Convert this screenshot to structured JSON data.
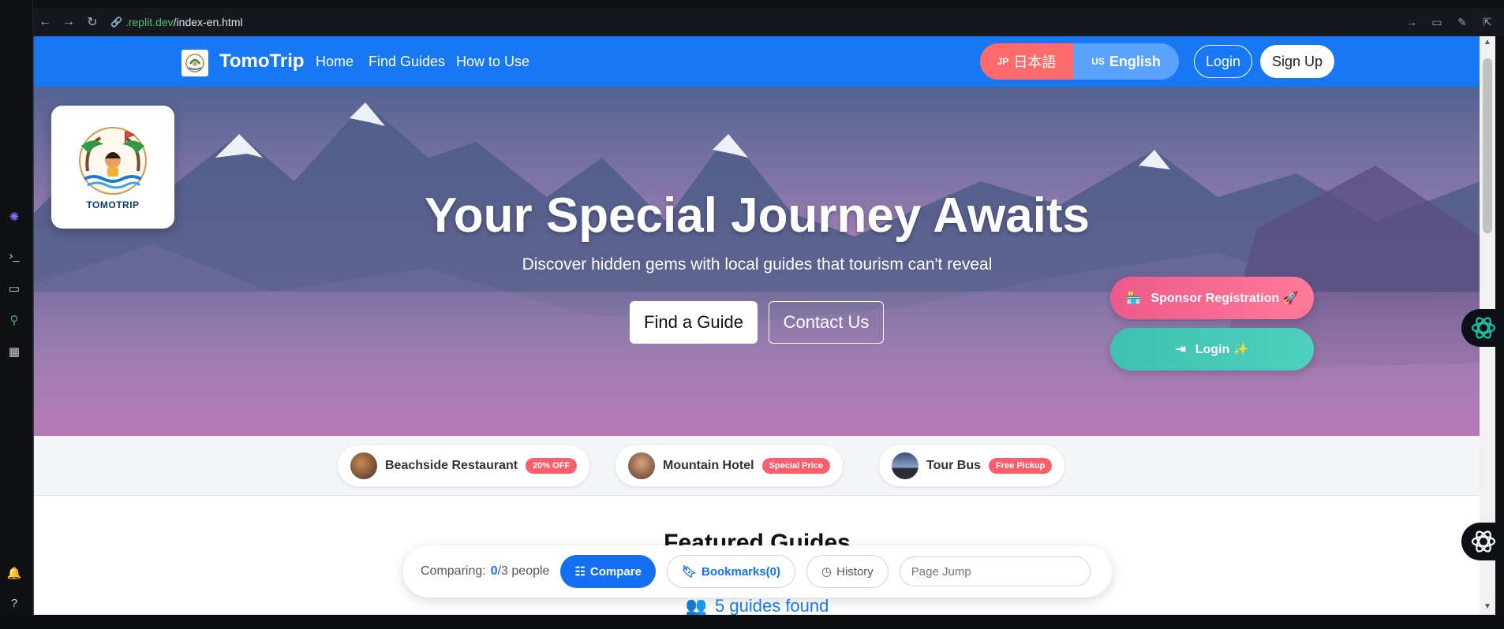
{
  "browser": {
    "url_domain": ".replit.dev",
    "url_path": "/index-en.html"
  },
  "nav": {
    "brand": "TomoTrip",
    "links": [
      "Home",
      "Find Guides",
      "How to Use"
    ],
    "lang_jp_code": "JP",
    "lang_jp_label": "日本語",
    "lang_en_code": "US",
    "lang_en_label": "English",
    "login": "Login",
    "signup": "Sign Up"
  },
  "hero": {
    "logo_label": "TOMOTRIP",
    "title": "Your Special Journey Awaits",
    "subtitle": "Discover hidden gems with local guides that tourism can't reveal",
    "find_guide": "Find a Guide",
    "contact_us": "Contact Us",
    "sponsor_registration": "Sponsor Registration 🚀",
    "side_login": "Login ✨"
  },
  "sponsors": [
    {
      "name": "Beachside Restaurant",
      "tag": "20% OFF"
    },
    {
      "name": "Mountain Hotel",
      "tag": "Special Price"
    },
    {
      "name": "Tour Bus",
      "tag": "Free Pickup"
    }
  ],
  "section": {
    "title": "Featured Guides",
    "found": "5 guides found"
  },
  "compare_bar": {
    "comparing_label": "Comparing:",
    "count": "0",
    "max": "/3 people",
    "compare": "Compare",
    "bookmarks": "Bookmarks(0)",
    "history": "History",
    "page_jump_placeholder": "Page Jump"
  },
  "colors": {
    "nav_blue": "#1877f2",
    "lang_jp": "#ff6b6b",
    "lang_en": "#5aa2ff",
    "sponsor_pink": "#ee5a8a",
    "login_teal": "#3ec1b3",
    "tag_red": "#ff5f6d"
  }
}
